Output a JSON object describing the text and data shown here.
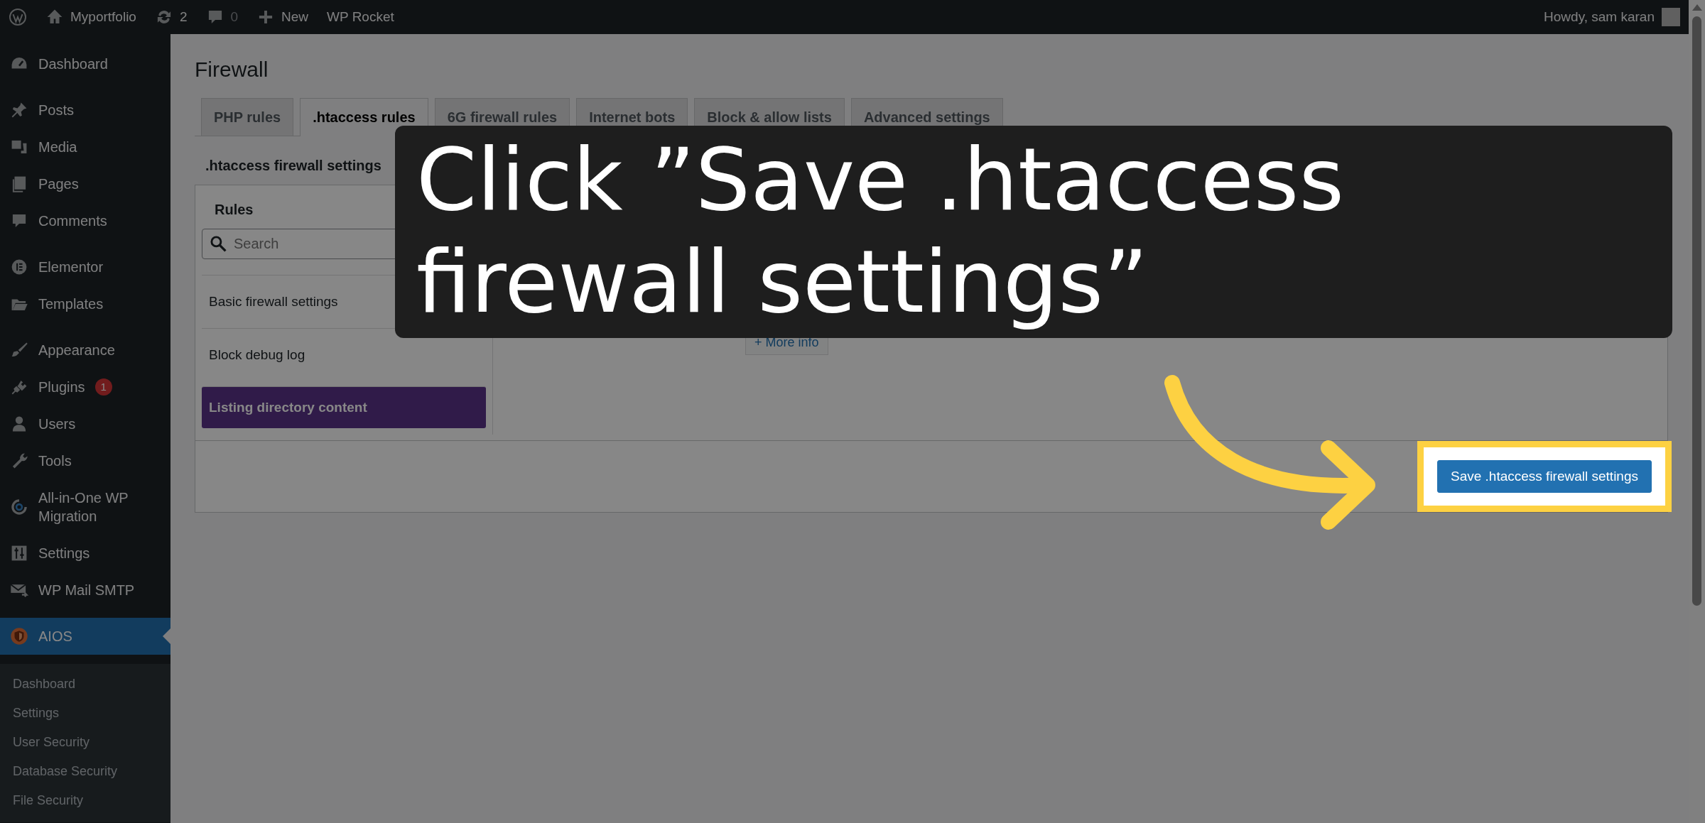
{
  "admin_bar": {
    "site": "Myportfolio",
    "updates": "2",
    "comments": "0",
    "new_label": "New",
    "plugin_link": "WP Rocket",
    "greeting": "Howdy, sam karan"
  },
  "sidebar": {
    "groups": [
      {
        "items": [
          {
            "label": "Dashboard",
            "selected": false
          }
        ]
      },
      {
        "items": [
          {
            "label": "Posts",
            "selected": false
          },
          {
            "label": "Media",
            "selected": false
          },
          {
            "label": "Pages",
            "selected": false
          },
          {
            "label": "Comments",
            "selected": false
          }
        ]
      },
      {
        "items": [
          {
            "label": "Elementor",
            "selected": false
          },
          {
            "label": "Templates",
            "selected": false
          }
        ]
      },
      {
        "items": [
          {
            "label": "Appearance",
            "selected": false
          },
          {
            "label": "Plugins",
            "selected": false,
            "badge": "1"
          },
          {
            "label": "Users",
            "selected": false
          },
          {
            "label": "Tools",
            "selected": false
          },
          {
            "label": "All-in-One WP Migration",
            "selected": false
          },
          {
            "label": "Settings",
            "selected": false
          },
          {
            "label": "WP Mail SMTP",
            "selected": false
          }
        ]
      },
      {
        "items": [
          {
            "label": "AIOS",
            "selected": true
          }
        ]
      }
    ],
    "submenu": [
      "Dashboard",
      "Settings",
      "User Security",
      "Database Security",
      "File Security"
    ]
  },
  "page": {
    "title": "Firewall",
    "tabs": [
      {
        "label": "PHP rules",
        "selected": false
      },
      {
        "label": ".htaccess rules",
        "selected": true
      },
      {
        "label": "6G firewall rules",
        "selected": false
      },
      {
        "label": "Internet bots",
        "selected": false
      },
      {
        "label": "Block & allow lists",
        "selected": false
      },
      {
        "label": "Advanced settings",
        "selected": false
      }
    ],
    "section_title": ".htaccess firewall settings",
    "rules_heading": "Rules",
    "search": {
      "placeholder": "Search"
    },
    "rules": [
      {
        "label": "Basic firewall settings",
        "selected": false
      },
      {
        "label": "Block debug log",
        "selected": false
      },
      {
        "label": "Listing directory content",
        "selected": true
      }
    ],
    "more_info": "+ More info",
    "save_button": "Save .htaccess firewall settings"
  },
  "callout": {
    "text": "Click ”Save .htaccess firewall settings”"
  }
}
